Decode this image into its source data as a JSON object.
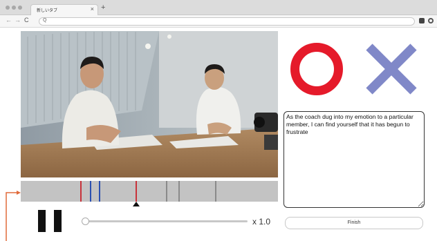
{
  "browser": {
    "tab_title": "新しいタブ",
    "tab_close": "×",
    "new_tab": "+",
    "back": "←",
    "forward": "→",
    "reload": "C",
    "search_glyph": "Q",
    "address": ""
  },
  "player": {
    "speed_label": "x 1.0",
    "playback_position": 0,
    "state": "paused"
  },
  "timeline": {
    "markers": [
      {
        "pos": 0.232,
        "color": "#c8323a"
      },
      {
        "pos": 0.268,
        "color": "#2a4fb0"
      },
      {
        "pos": 0.305,
        "color": "#2a4fb0"
      },
      {
        "pos": 0.445,
        "color": "#c8323a"
      },
      {
        "pos": 0.565,
        "color": "#8a8a8a"
      },
      {
        "pos": 0.614,
        "color": "#8a8a8a"
      },
      {
        "pos": 0.755,
        "color": "#8a8a8a"
      }
    ],
    "cursor_pos": 0.449
  },
  "judgement": {
    "yes_color": "#e51a2a",
    "no_color": "#8088c8"
  },
  "comment": {
    "text": "As the coach dug into my emotion to a particular member, I can find yourself that it has begun to frustrate"
  },
  "finish_label": "Finish",
  "annotation_color": "#e06a3a"
}
